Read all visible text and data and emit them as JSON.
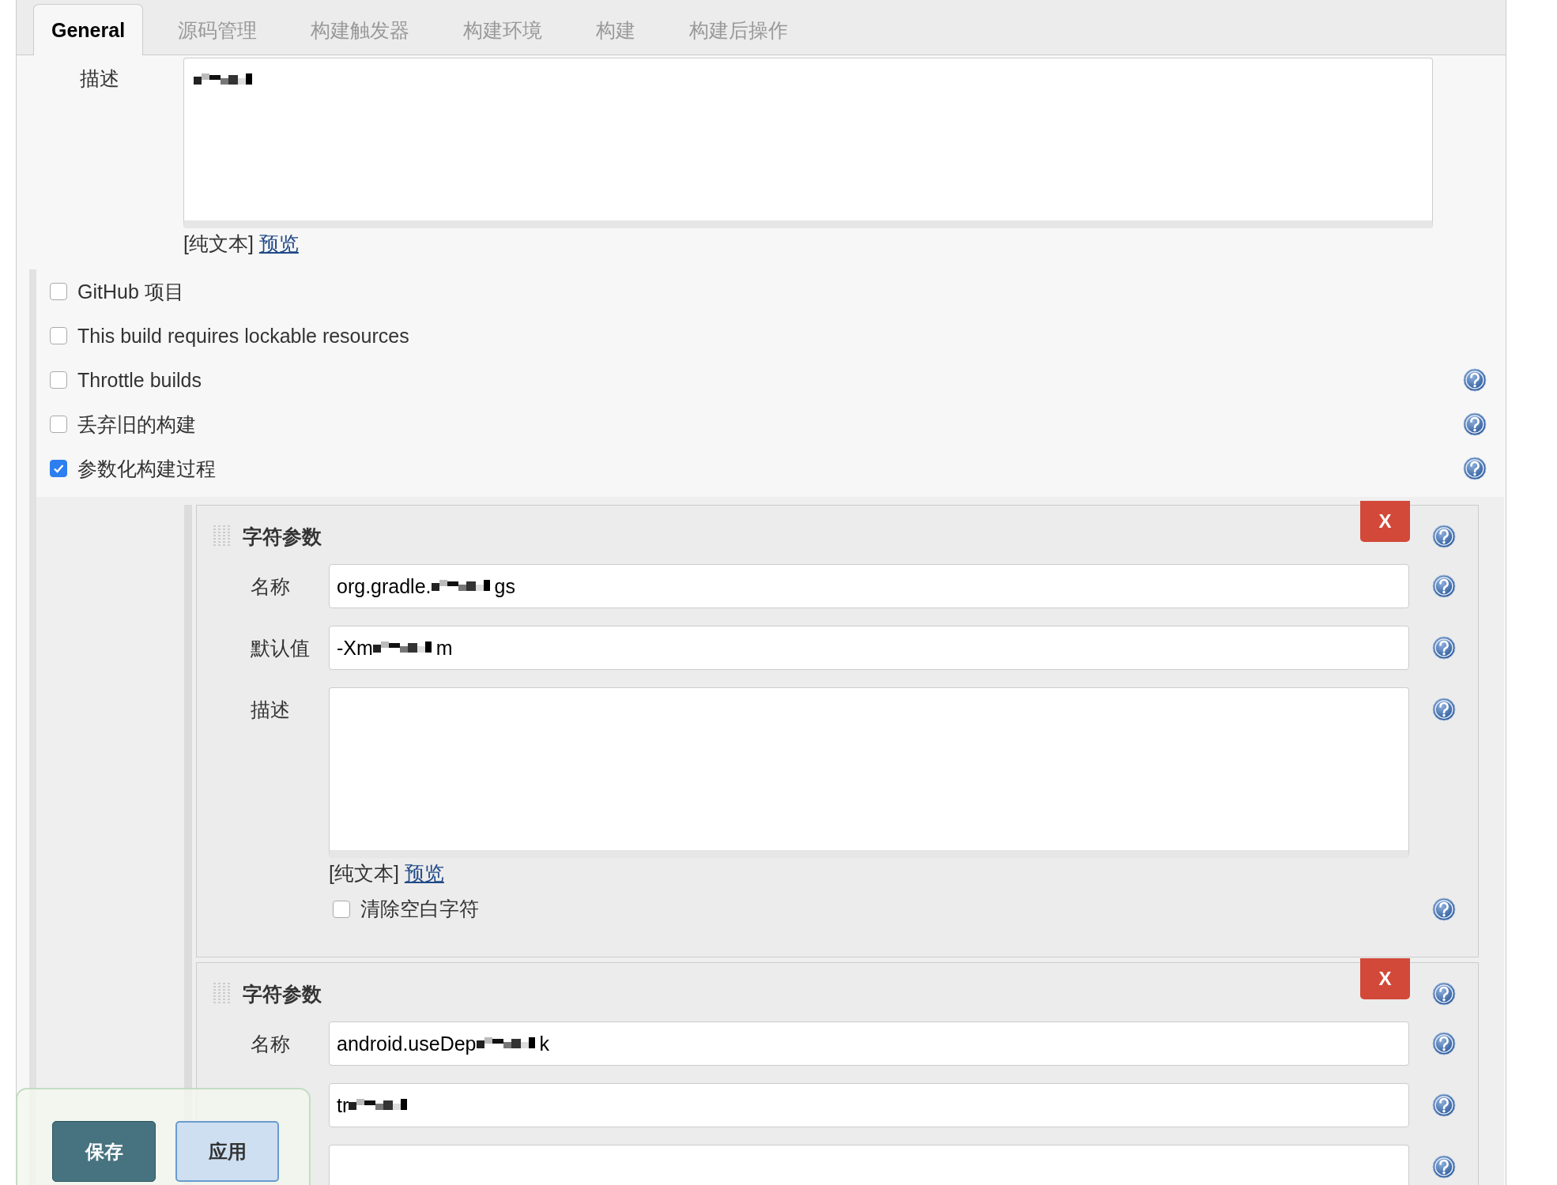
{
  "tabs": [
    {
      "label": "General",
      "selected": true
    },
    {
      "label": "源码管理",
      "selected": false
    },
    {
      "label": "构建触发器",
      "selected": false
    },
    {
      "label": "构建环境",
      "selected": false
    },
    {
      "label": "构建",
      "selected": false
    },
    {
      "label": "构建后操作",
      "selected": false
    }
  ],
  "description": {
    "label": "描述",
    "redacted": true,
    "hint": "[纯文本]",
    "link": "预览"
  },
  "options": [
    {
      "label": "GitHub 项目",
      "checked": false,
      "help": false
    },
    {
      "label": "This build requires lockable resources",
      "checked": false,
      "help": false
    },
    {
      "label": "Throttle builds",
      "checked": false,
      "help": true
    },
    {
      "label": "丢弃旧的构建",
      "checked": false,
      "help": true
    },
    {
      "label": "参数化构建过程",
      "checked": true,
      "help": true
    }
  ],
  "parameters": [
    {
      "title": "字符参数",
      "delete": "X",
      "fields": [
        {
          "kind": "text",
          "label": "名称",
          "value": "org.gradle.",
          "redacted": true,
          "tail": "gs"
        },
        {
          "kind": "text",
          "label": "默认值",
          "value": "-Xm",
          "redacted": true,
          "tail": "m"
        },
        {
          "kind": "textarea",
          "label": "描述",
          "hint": "[纯文本]",
          "link": "预览"
        },
        {
          "kind": "checkbox",
          "label": "清除空白字符",
          "checked": false
        }
      ]
    },
    {
      "title": "字符参数",
      "delete": "X",
      "fields": [
        {
          "kind": "text",
          "label": "名称",
          "value": "android.useDep",
          "redacted": true,
          "tail": "k"
        },
        {
          "kind": "text",
          "value": "tr",
          "redacted": true
        },
        {
          "kind": "textarea"
        }
      ]
    }
  ],
  "footer": {
    "buttons": [
      {
        "label": "保存",
        "kind": "primary"
      },
      {
        "label": "应用",
        "kind": "secondary"
      }
    ]
  }
}
